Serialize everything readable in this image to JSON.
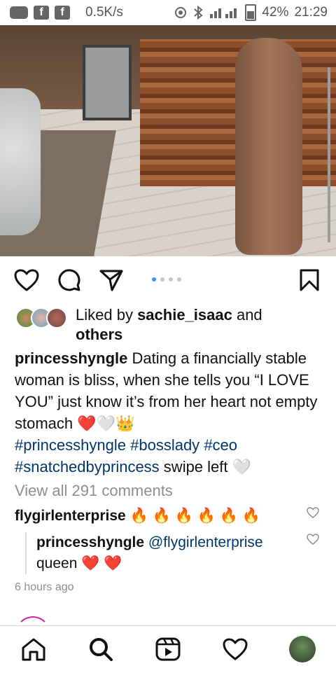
{
  "status_bar": {
    "speed": "0.5K/s",
    "battery": "42%",
    "time": "21:29",
    "app_icon_letter": "f",
    "icons": [
      "message-icon",
      "facebook-icon",
      "facebook-icon",
      "hotspot-icon",
      "bluetooth-icon",
      "signal-icon",
      "battery-icon"
    ]
  },
  "post": {
    "carousel": {
      "total": 4,
      "active": 0
    },
    "likes": {
      "prefix": "Liked by ",
      "user": "sachie_isaac",
      "suffix": " and",
      "others": "others"
    },
    "caption": {
      "username": "princesshyngle",
      "text": " Dating a financially stable woman is bliss, when she tells you “I LOVE YOU” just know it’s from her heart not empty stomach ❤️🤍👑",
      "hashtags": [
        "#princesshyngle",
        "#bosslady",
        "#ceo",
        "#snatchedbyprincess"
      ],
      "after": " swipe left 🤍"
    },
    "view_comments": "View all 291 comments",
    "comment": {
      "username": "flygirlenterprise",
      "text": " 🔥 🔥 🔥 🔥 🔥 🔥"
    },
    "reply": {
      "username": "princesshyngle",
      "mention": "@flygirlenterprise",
      "text": "queen ❤️ ❤️"
    },
    "timestamp": "6 hours ago"
  },
  "colors": {
    "link": "#00376b",
    "muted": "#8e8e8e",
    "active_dot": "#3897f0",
    "heart": "#e84a8c"
  },
  "nav": [
    "home-icon",
    "search-icon",
    "reels-icon",
    "activity-icon",
    "profile-avatar"
  ]
}
